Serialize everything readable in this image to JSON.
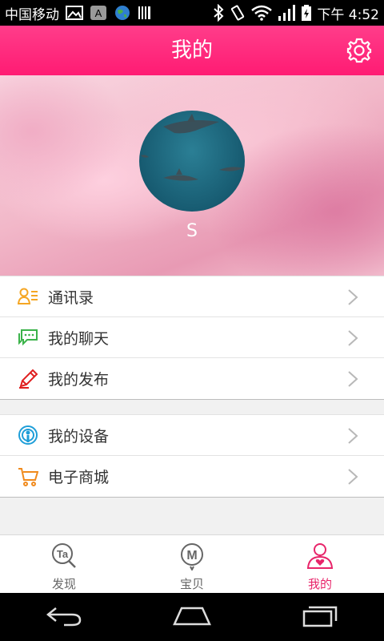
{
  "status_bar": {
    "carrier": "中国移动",
    "time": "下午 4:52",
    "icons": [
      "image-icon",
      "a-icon",
      "globe-icon",
      "barcode-icon",
      "bluetooth-icon",
      "vibrate-icon",
      "wifi-icon",
      "signal-icon",
      "battery-icon"
    ]
  },
  "header": {
    "title": "我的",
    "settings_icon": "gear-icon",
    "accent": "#ff2a7d"
  },
  "profile": {
    "username": "S",
    "avatar_icon": "shark-avatar"
  },
  "menu_group_1": [
    {
      "label": "通讯录",
      "icon": "contacts-icon",
      "color": "#f5a623"
    },
    {
      "label": "我的聊天",
      "icon": "chat-icon",
      "color": "#3bb34a"
    },
    {
      "label": "我的发布",
      "icon": "pencil-icon",
      "color": "#e02020"
    }
  ],
  "menu_group_2": [
    {
      "label": "我的设备",
      "icon": "device-icon",
      "color": "#1e9ed8"
    },
    {
      "label": "电子商城",
      "icon": "cart-icon",
      "color": "#f08a1c"
    }
  ],
  "tabs": [
    {
      "label": "发现",
      "icon": "discover-icon",
      "active": false
    },
    {
      "label": "宝贝",
      "icon": "baby-icon",
      "active": false
    },
    {
      "label": "我的",
      "icon": "me-icon",
      "active": true
    }
  ],
  "active_color": "#e8256a",
  "nav_bar": [
    "back-icon",
    "home-icon",
    "recent-apps-icon"
  ]
}
